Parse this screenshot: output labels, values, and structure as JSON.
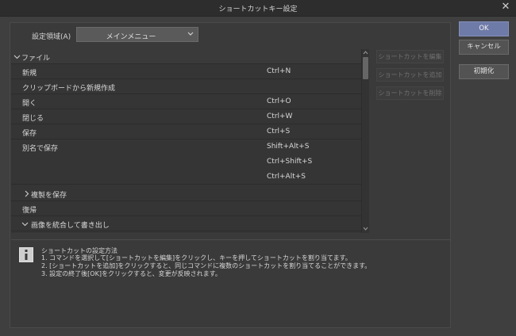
{
  "window": {
    "title": "ショートカットキー設定"
  },
  "settings_area": {
    "label": "設定領域(A)",
    "selected": "メインメニュー"
  },
  "tree": {
    "category": "ファイル",
    "rows": [
      {
        "name": "新規",
        "shortcut": "Ctrl+N"
      },
      {
        "name": "クリップボードから新規作成",
        "shortcut": ""
      },
      {
        "name": "開く",
        "shortcut": "Ctrl+O"
      },
      {
        "name": "閉じる",
        "shortcut": "Ctrl+W"
      },
      {
        "name": "保存",
        "shortcut": "Ctrl+S"
      },
      {
        "name": "別名で保存",
        "shortcut": "Shift+Alt+S"
      },
      {
        "name": "",
        "shortcut": "Ctrl+Shift+S"
      },
      {
        "name": "",
        "shortcut": "Ctrl+Alt+S"
      },
      {
        "name": "複製を保存",
        "shortcut": ""
      },
      {
        "name": "復帰",
        "shortcut": ""
      },
      {
        "name": "画像を統合して書き出し",
        "shortcut": ""
      }
    ]
  },
  "side_buttons": {
    "edit": "ショートカットを編集",
    "add": "ショートカットを追加",
    "delete": "ショートカットを削除"
  },
  "dialog_buttons": {
    "ok": "OK",
    "cancel": "キャンセル",
    "reset": "初期化"
  },
  "help": {
    "title": "ショートカットの設定方法",
    "lines": [
      "1. コマンドを選択して[ショートカットを編集]をクリックし、キーを押してショートカットを割り当てます。",
      "2. [ショートカットを追加]をクリックすると、同じコマンドに複数のショートカットを割り当てることができます。",
      "3. 設定の終了後[OK]をクリックすると、変更が反映されます。"
    ]
  },
  "colors": {
    "background": "#3f3f3f",
    "accent": "#6e7aa8",
    "disabled_text": "#6f6f6f"
  },
  "icons": [
    "close-icon",
    "chevron-down-icon",
    "chevron-right-icon",
    "info-icon"
  ]
}
